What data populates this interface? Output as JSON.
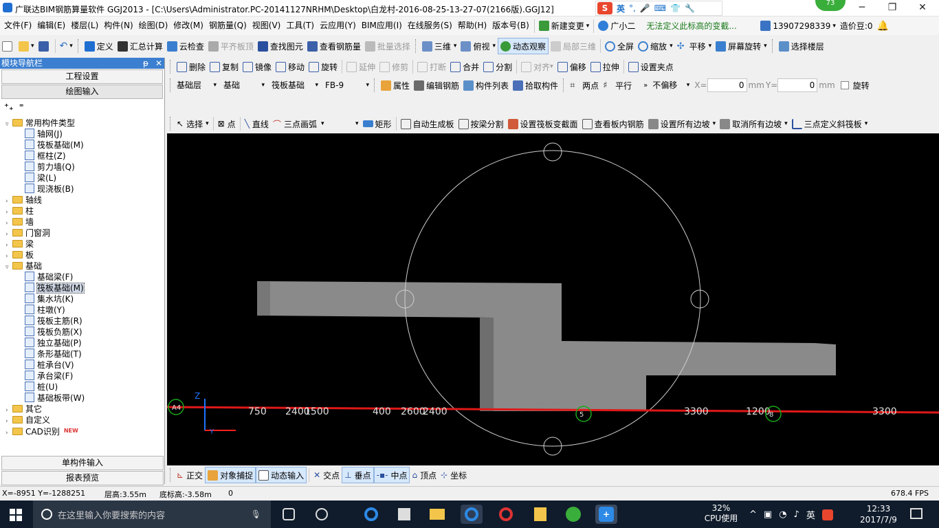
{
  "window": {
    "title": "广联达BIM钢筋算量软件 GGJ2013 - [C:\\Users\\Administrator.PC-20141127NRHM\\Desktop\\白龙村-2016-08-25-13-27-07(2166版).GGJ12]",
    "minimize": "─",
    "restore": "❐",
    "close": "✕"
  },
  "ime": {
    "lang": "英",
    "badge": "73"
  },
  "menubar": {
    "items": [
      "文件(F)",
      "编辑(E)",
      "楼层(L)",
      "构件(N)",
      "绘图(D)",
      "修改(M)",
      "钢筋量(Q)",
      "视图(V)",
      "工具(T)",
      "云应用(Y)",
      "BIM应用(I)",
      "在线服务(S)",
      "帮助(H)",
      "版本号(B)"
    ],
    "new_change": "新建变更",
    "assistant": "广小二",
    "notice": "无法定义此标高的变截...",
    "phone": "13907298339",
    "beans": "造价豆:0"
  },
  "toolbar1": {
    "items": [
      "定义",
      "汇总计算",
      "云检查",
      "平齐板顶",
      "查找图元",
      "查看钢筋量",
      "批量选择"
    ],
    "view3d": "三维",
    "topview": "俯视",
    "dynamic": "动态观察",
    "local3d": "局部三维",
    "fullscreen": "全屏",
    "zoom": "缩放",
    "pan": "平移",
    "rotate": "屏幕旋转",
    "floor": "选择楼层"
  },
  "toolbar2": {
    "items": [
      "删除",
      "复制",
      "镜像",
      "移动",
      "旋转",
      "延伸",
      "修剪",
      "打断",
      "合并",
      "分割",
      "对齐",
      "偏移",
      "拉伸",
      "设置夹点"
    ]
  },
  "toolbar3": {
    "layer": "基础层",
    "category": "基础",
    "type": "筏板基础",
    "name": "FB-9",
    "attr": "属性",
    "edit_rebar": "编辑钢筋",
    "list": "构件列表",
    "pick": "拾取构件",
    "twopoint": "两点",
    "parallel": "平行",
    "offset_mode": "不偏移",
    "x_label": "X=",
    "x_value": "0",
    "y_label": "Y=",
    "y_value": "0",
    "unit": "mm",
    "rotate": "旋转"
  },
  "toolbar4": {
    "select": "选择",
    "point": "点",
    "line": "直线",
    "arc": "三点画弧",
    "rect": "矩形",
    "auto": "自动生成板",
    "beam_split": "按梁分割",
    "set_variable": "设置筏板变截面",
    "view_rebar": "查看板内钢筋",
    "set_all_slope": "设置所有边坡",
    "cancel_all_slope": "取消所有边坡",
    "three_point_slope": "三点定义斜筏板"
  },
  "nav": {
    "title": "模块导航栏",
    "pin": "ᵽ",
    "close": "✕",
    "btn_project": "工程设置",
    "btn_draw": "绘图输入",
    "btn_single": "单构件输入",
    "btn_report": "报表预览",
    "tree": [
      {
        "t": "常用构件类型",
        "lvl": 0,
        "kind": "folder",
        "exp": "▿"
      },
      {
        "t": "轴网(J)",
        "lvl": 1,
        "kind": "item"
      },
      {
        "t": "筏板基础(M)",
        "lvl": 1,
        "kind": "item"
      },
      {
        "t": "框柱(Z)",
        "lvl": 1,
        "kind": "item"
      },
      {
        "t": "剪力墙(Q)",
        "lvl": 1,
        "kind": "item"
      },
      {
        "t": "梁(L)",
        "lvl": 1,
        "kind": "item"
      },
      {
        "t": "现浇板(B)",
        "lvl": 1,
        "kind": "item"
      },
      {
        "t": "轴线",
        "lvl": 0,
        "kind": "folder",
        "exp": "›"
      },
      {
        "t": "柱",
        "lvl": 0,
        "kind": "folder",
        "exp": "›"
      },
      {
        "t": "墙",
        "lvl": 0,
        "kind": "folder",
        "exp": "›"
      },
      {
        "t": "门窗洞",
        "lvl": 0,
        "kind": "folder",
        "exp": "›"
      },
      {
        "t": "梁",
        "lvl": 0,
        "kind": "folder",
        "exp": "›"
      },
      {
        "t": "板",
        "lvl": 0,
        "kind": "folder",
        "exp": "›"
      },
      {
        "t": "基础",
        "lvl": 0,
        "kind": "folder",
        "exp": "▿"
      },
      {
        "t": "基础梁(F)",
        "lvl": 1,
        "kind": "item"
      },
      {
        "t": "筏板基础(M)",
        "lvl": 1,
        "kind": "item",
        "sel": true
      },
      {
        "t": "集水坑(K)",
        "lvl": 1,
        "kind": "item"
      },
      {
        "t": "柱墩(Y)",
        "lvl": 1,
        "kind": "item"
      },
      {
        "t": "筏板主筋(R)",
        "lvl": 1,
        "kind": "item"
      },
      {
        "t": "筏板负筋(X)",
        "lvl": 1,
        "kind": "item"
      },
      {
        "t": "独立基础(P)",
        "lvl": 1,
        "kind": "item"
      },
      {
        "t": "条形基础(T)",
        "lvl": 1,
        "kind": "item"
      },
      {
        "t": "桩承台(V)",
        "lvl": 1,
        "kind": "item"
      },
      {
        "t": "承台梁(F)",
        "lvl": 1,
        "kind": "item"
      },
      {
        "t": "桩(U)",
        "lvl": 1,
        "kind": "item"
      },
      {
        "t": "基础板带(W)",
        "lvl": 1,
        "kind": "item"
      },
      {
        "t": "其它",
        "lvl": 0,
        "kind": "folder",
        "exp": "›"
      },
      {
        "t": "自定义",
        "lvl": 0,
        "kind": "folder",
        "exp": "›"
      },
      {
        "t": "CAD识别",
        "lvl": 0,
        "kind": "folder",
        "exp": "›",
        "new": "NEW"
      }
    ]
  },
  "canvas": {
    "dims": [
      "750",
      "2400",
      "1500",
      "400",
      "2600",
      "2400",
      "3300",
      "1200",
      "3300"
    ],
    "axis_labels": [
      "A4",
      "5",
      "8"
    ],
    "z": "Z",
    "y": "Y"
  },
  "snapbar": {
    "ortho": "正交",
    "osnap": "对象捕捉",
    "dyninput": "动态输入",
    "intersect": "交点",
    "perp": "垂点",
    "mid": "中点",
    "vertex": "顶点",
    "coord": "坐标"
  },
  "status": {
    "coords": "X=-8951 Y=-1288251",
    "floor_h": "层高:3.55m",
    "bottom_h": "底标高:-3.58m",
    "zero": "0",
    "fps": "678.4 FPS"
  },
  "taskbar": {
    "search": "在这里输入你要搜索的内容",
    "cpu_pct": "32%",
    "cpu_label": "CPU使用",
    "ime": "英",
    "time": "12:33",
    "date": "2017/7/9"
  }
}
